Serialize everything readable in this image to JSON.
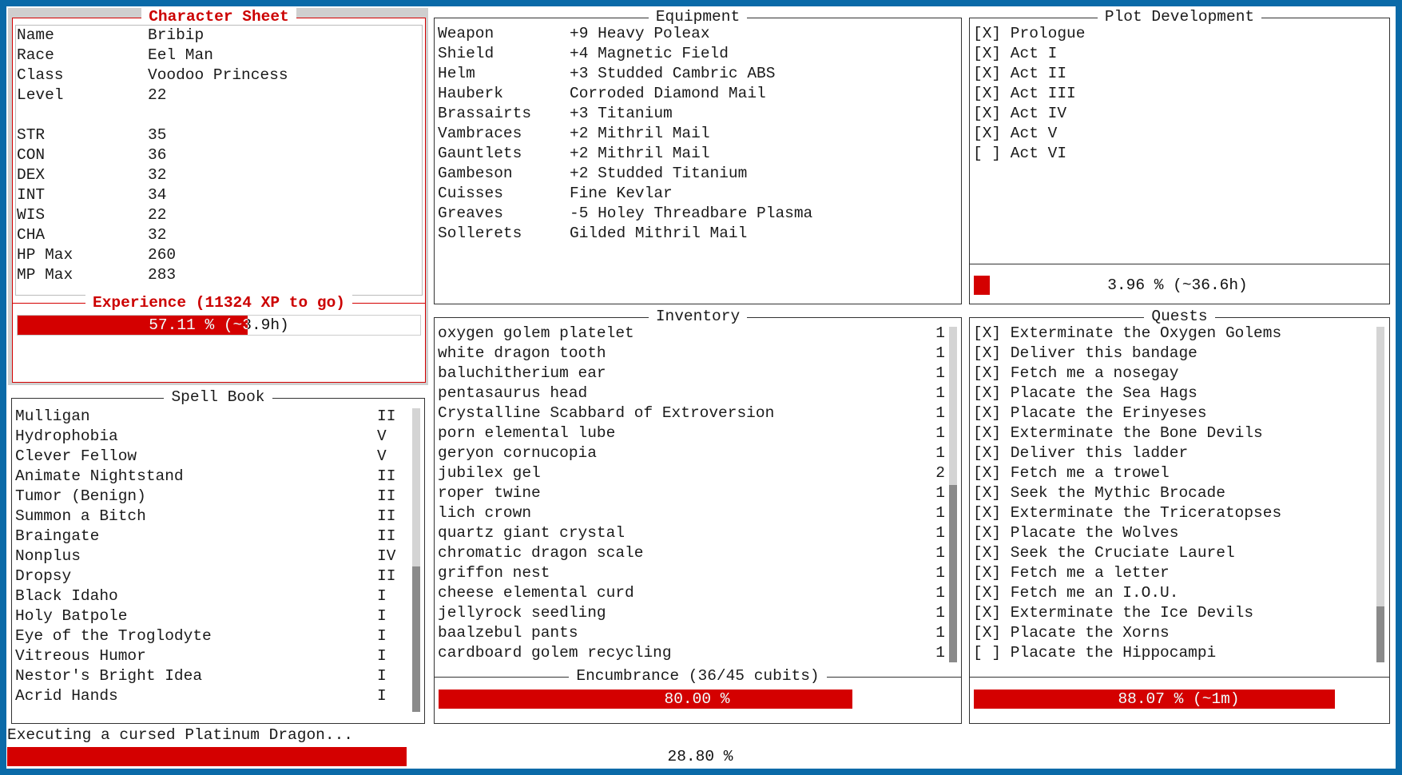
{
  "colors": {
    "accent": "#d40000",
    "background": "#0a6aa8",
    "scroll_track": "#d4d4d4",
    "scroll_thumb": "#8a8a8a"
  },
  "character": {
    "title": "Character Sheet",
    "fields": [
      {
        "key": "Name",
        "value": "Bribip"
      },
      {
        "key": "Race",
        "value": "Eel Man"
      },
      {
        "key": "Class",
        "value": "Voodoo Princess"
      },
      {
        "key": "Level",
        "value": "22"
      },
      {
        "key": "",
        "value": ""
      },
      {
        "key": "STR",
        "value": "35"
      },
      {
        "key": "CON",
        "value": "36"
      },
      {
        "key": "DEX",
        "value": "32"
      },
      {
        "key": "INT",
        "value": "34"
      },
      {
        "key": "WIS",
        "value": "22"
      },
      {
        "key": "CHA",
        "value": "32"
      },
      {
        "key": "HP Max",
        "value": "260"
      },
      {
        "key": "MP Max",
        "value": "283"
      }
    ],
    "experience_title": "Experience (11324 XP to go)",
    "experience_text": "57.11 % (~3.9h)",
    "experience_fraction": 0.5711
  },
  "spellbook": {
    "title": "Spell Book",
    "spells": [
      {
        "name": "Mulligan",
        "level": "II"
      },
      {
        "name": "Hydrophobia",
        "level": "V"
      },
      {
        "name": "Clever Fellow",
        "level": "V"
      },
      {
        "name": "Animate Nightstand",
        "level": "II"
      },
      {
        "name": "Tumor (Benign)",
        "level": "II"
      },
      {
        "name": "Summon a Bitch",
        "level": "II"
      },
      {
        "name": "Braingate",
        "level": "II"
      },
      {
        "name": "Nonplus",
        "level": "IV"
      },
      {
        "name": "Dropsy",
        "level": "II"
      },
      {
        "name": "Black Idaho",
        "level": "I"
      },
      {
        "name": "Holy Batpole",
        "level": "I"
      },
      {
        "name": "Eye of the Troglodyte",
        "level": "I"
      },
      {
        "name": "Vitreous Humor",
        "level": "I"
      },
      {
        "name": "Nestor's Bright Idea",
        "level": "I"
      },
      {
        "name": "Acrid Hands",
        "level": "I"
      }
    ]
  },
  "equipment": {
    "title": "Equipment",
    "items": [
      {
        "slot": "Weapon",
        "item": "+9 Heavy Poleax"
      },
      {
        "slot": "Shield",
        "item": "+4 Magnetic Field"
      },
      {
        "slot": "Helm",
        "item": "+3 Studded Cambric ABS"
      },
      {
        "slot": "Hauberk",
        "item": "Corroded Diamond Mail"
      },
      {
        "slot": "Brassairts",
        "item": "+3 Titanium"
      },
      {
        "slot": "Vambraces",
        "item": "+2 Mithril Mail"
      },
      {
        "slot": "Gauntlets",
        "item": "+2 Mithril Mail"
      },
      {
        "slot": "Gambeson",
        "item": "+2 Studded Titanium"
      },
      {
        "slot": "Cuisses",
        "item": "Fine Kevlar"
      },
      {
        "slot": "Greaves",
        "item": "-5 Holey Threadbare Plasma"
      },
      {
        "slot": "Sollerets",
        "item": "Gilded Mithril Mail"
      }
    ]
  },
  "inventory": {
    "title": "Inventory",
    "items": [
      {
        "name": "oxygen golem platelet",
        "qty": "1"
      },
      {
        "name": "white dragon tooth",
        "qty": "1"
      },
      {
        "name": "baluchitherium ear",
        "qty": "1"
      },
      {
        "name": "pentasaurus head",
        "qty": "1"
      },
      {
        "name": "Crystalline Scabbard of Extroversion",
        "qty": "1"
      },
      {
        "name": "porn elemental lube",
        "qty": "1"
      },
      {
        "name": "geryon cornucopia",
        "qty": "1"
      },
      {
        "name": "jubilex gel",
        "qty": "2"
      },
      {
        "name": "roper twine",
        "qty": "1"
      },
      {
        "name": "lich crown",
        "qty": "1"
      },
      {
        "name": "quartz giant crystal",
        "qty": "1"
      },
      {
        "name": "chromatic dragon scale",
        "qty": "1"
      },
      {
        "name": "griffon nest",
        "qty": "1"
      },
      {
        "name": "cheese elemental curd",
        "qty": "1"
      },
      {
        "name": "jellyrock seedling",
        "qty": "1"
      },
      {
        "name": "baalzebul pants",
        "qty": "1"
      },
      {
        "name": "cardboard golem recycling",
        "qty": "1"
      }
    ],
    "encumbrance_title": "Encumbrance (36/45 cubits)",
    "encumbrance_text": "80.00 %",
    "encumbrance_fraction": 0.8
  },
  "plot": {
    "title": "Plot Development",
    "acts": [
      {
        "label": "[X] Prologue"
      },
      {
        "label": "[X] Act I"
      },
      {
        "label": "[X] Act II"
      },
      {
        "label": "[X] Act III"
      },
      {
        "label": "[X] Act IV"
      },
      {
        "label": "[X] Act V"
      },
      {
        "label": "[ ] Act VI"
      }
    ],
    "progress_text": "3.96 % (~36.6h)",
    "progress_fraction": 0.0396
  },
  "quests": {
    "title": "Quests",
    "items": [
      {
        "label": "[X] Exterminate the Oxygen Golems"
      },
      {
        "label": "[X] Deliver this bandage"
      },
      {
        "label": "[X] Fetch me a nosegay"
      },
      {
        "label": "[X] Placate the Sea Hags"
      },
      {
        "label": "[X] Placate the Erinyeses"
      },
      {
        "label": "[X] Exterminate the Bone Devils"
      },
      {
        "label": "[X] Deliver this ladder"
      },
      {
        "label": "[X] Fetch me a trowel"
      },
      {
        "label": "[X] Seek the Mythic Brocade"
      },
      {
        "label": "[X] Exterminate the Triceratopses"
      },
      {
        "label": "[X] Placate the Wolves"
      },
      {
        "label": "[X] Seek the Cruciate Laurel"
      },
      {
        "label": "[X] Fetch me a letter"
      },
      {
        "label": "[X] Fetch me an I.O.U."
      },
      {
        "label": "[X] Exterminate the Ice Devils"
      },
      {
        "label": "[X] Placate the Xorns"
      },
      {
        "label": "[ ] Placate the Hippocampi"
      }
    ],
    "progress_text": "88.07 % (~1m)",
    "progress_fraction": 0.8807
  },
  "status": {
    "task": "Executing a cursed Platinum Dragon...",
    "progress_text": "28.80 %",
    "progress_fraction": 0.288
  }
}
